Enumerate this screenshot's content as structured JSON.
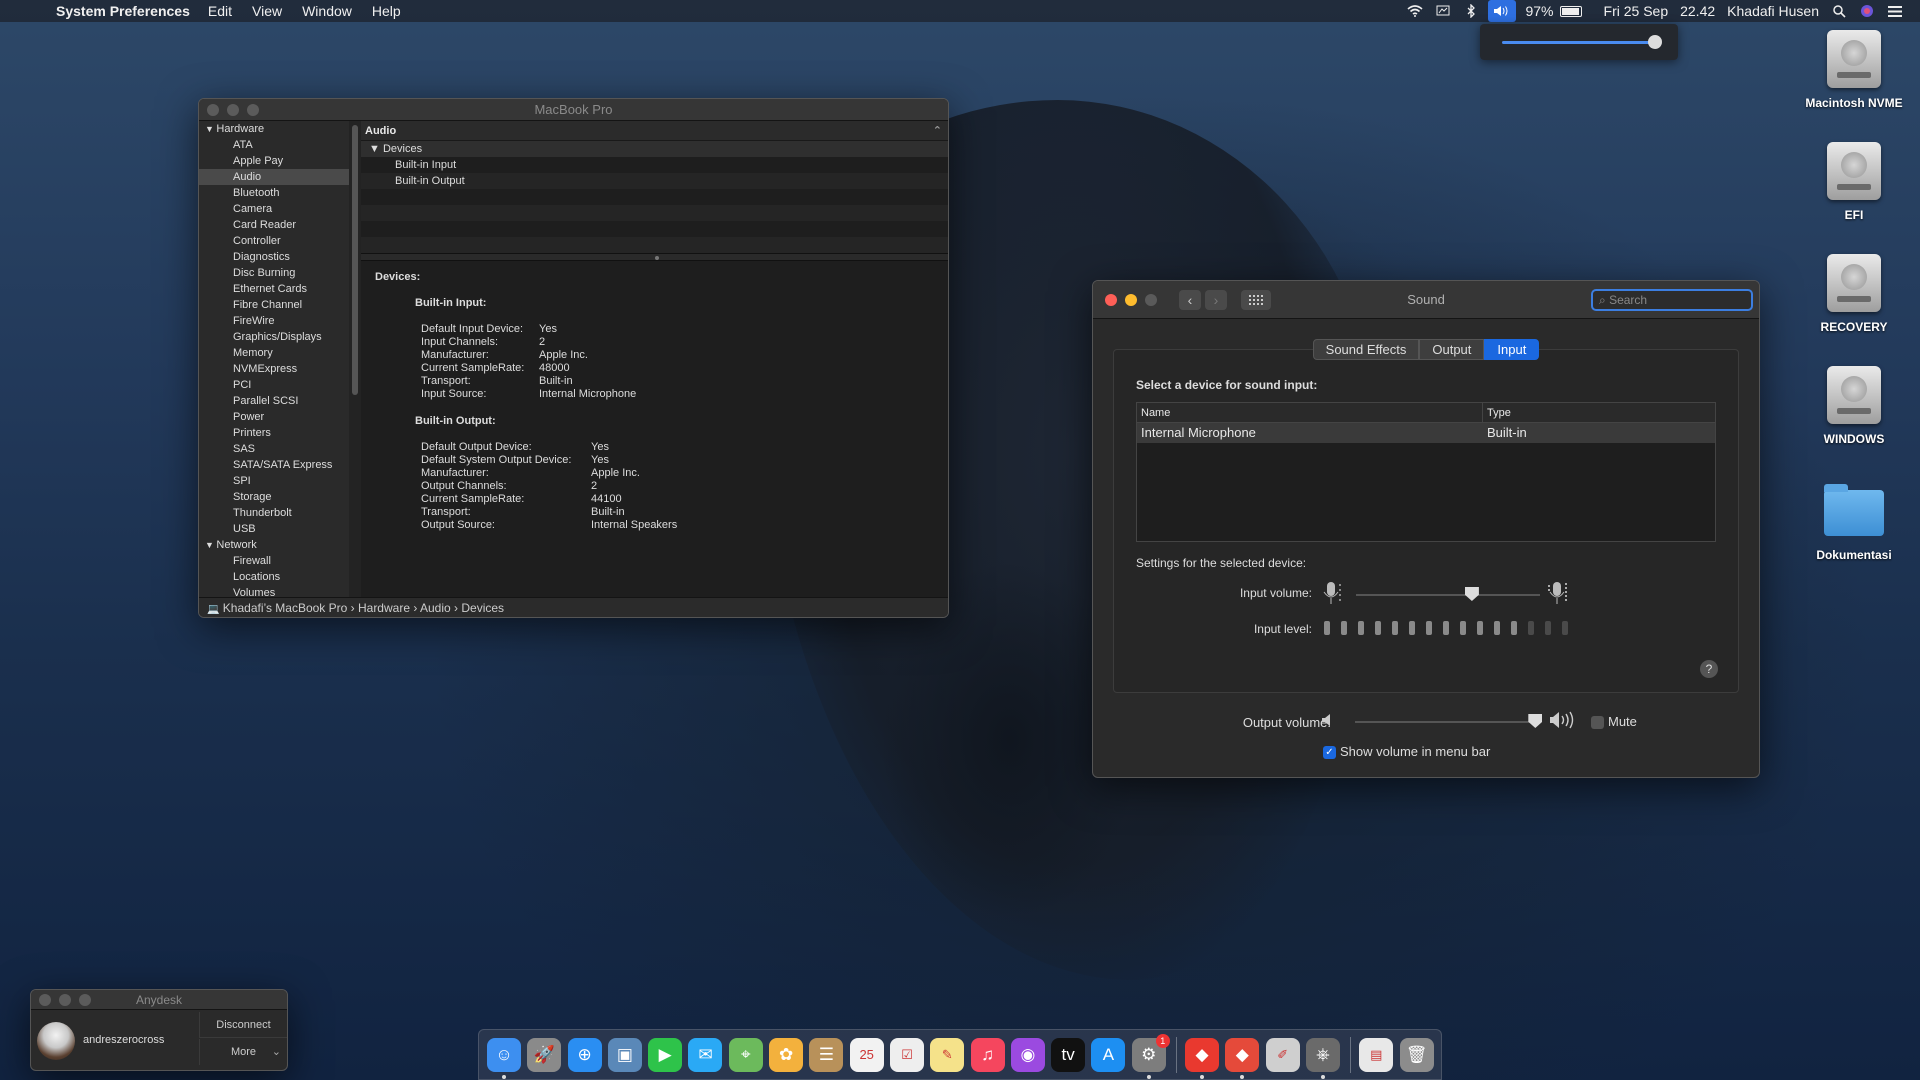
{
  "menubar": {
    "app_name": "System Preferences",
    "menus": [
      "Edit",
      "View",
      "Window",
      "Help"
    ],
    "battery_percent": "97%",
    "battery_level": 0.97,
    "date": "Fri 25 Sep",
    "time": "22.42",
    "user": "Khadafi Husen",
    "icons": [
      "wifi-icon",
      "display-icon",
      "bluetooth-icon",
      "volume-icon",
      "battery-icon",
      "spotlight-icon",
      "siri-icon",
      "notification-center-icon"
    ]
  },
  "volume_popup": {
    "level": 1.0
  },
  "desktop_icons": [
    {
      "label": "Macintosh NVME",
      "type": "disk"
    },
    {
      "label": "EFI",
      "type": "disk"
    },
    {
      "label": "RECOVERY",
      "type": "disk"
    },
    {
      "label": "WINDOWS",
      "type": "disk"
    },
    {
      "label": "Dokumentasi",
      "type": "folder"
    }
  ],
  "sysinfo": {
    "title": "MacBook Pro",
    "sidebar": [
      {
        "label": "Hardware",
        "group": true
      },
      {
        "label": "ATA"
      },
      {
        "label": "Apple Pay"
      },
      {
        "label": "Audio",
        "selected": true
      },
      {
        "label": "Bluetooth"
      },
      {
        "label": "Camera"
      },
      {
        "label": "Card Reader"
      },
      {
        "label": "Controller"
      },
      {
        "label": "Diagnostics"
      },
      {
        "label": "Disc Burning"
      },
      {
        "label": "Ethernet Cards"
      },
      {
        "label": "Fibre Channel"
      },
      {
        "label": "FireWire"
      },
      {
        "label": "Graphics/Displays"
      },
      {
        "label": "Memory"
      },
      {
        "label": "NVMExpress"
      },
      {
        "label": "PCI"
      },
      {
        "label": "Parallel SCSI"
      },
      {
        "label": "Power"
      },
      {
        "label": "Printers"
      },
      {
        "label": "SAS"
      },
      {
        "label": "SATA/SATA Express"
      },
      {
        "label": "SPI"
      },
      {
        "label": "Storage"
      },
      {
        "label": "Thunderbolt"
      },
      {
        "label": "USB"
      },
      {
        "label": "Network",
        "group": true
      },
      {
        "label": "Firewall"
      },
      {
        "label": "Locations"
      },
      {
        "label": "Volumes"
      }
    ],
    "section_header": "Audio",
    "tree_group": "Devices",
    "tree_items": [
      "Built-in Input",
      "Built-in Output"
    ],
    "detail_heading": "Devices:",
    "input_heading": "Built-in Input:",
    "input_props": [
      {
        "k": "Default Input Device:",
        "v": "Yes"
      },
      {
        "k": "Input Channels:",
        "v": "2"
      },
      {
        "k": "Manufacturer:",
        "v": "Apple Inc."
      },
      {
        "k": "Current SampleRate:",
        "v": "48000"
      },
      {
        "k": "Transport:",
        "v": "Built-in"
      },
      {
        "k": "Input Source:",
        "v": "Internal Microphone"
      }
    ],
    "output_heading": "Built-in Output:",
    "output_props": [
      {
        "k": "Default Output Device:",
        "v": "Yes"
      },
      {
        "k": "Default System Output Device:",
        "v": "Yes"
      },
      {
        "k": "Manufacturer:",
        "v": "Apple Inc."
      },
      {
        "k": "Output Channels:",
        "v": "2"
      },
      {
        "k": "Current SampleRate:",
        "v": "44100"
      },
      {
        "k": "Transport:",
        "v": "Built-in"
      },
      {
        "k": "Output Source:",
        "v": "Internal Speakers"
      }
    ],
    "breadcrumb": "Khadafi’s MacBook Pro  ›  Hardware  ›  Audio  ›  Devices"
  },
  "sound": {
    "title": "Sound",
    "search_placeholder": "Search",
    "tabs": [
      "Sound Effects",
      "Output",
      "Input"
    ],
    "selected_tab": "Input",
    "select_device_label": "Select a device for sound input:",
    "col_name": "Name",
    "col_type": "Type",
    "device_name": "Internal Microphone",
    "device_type": "Built-in",
    "settings_label": "Settings for the selected device:",
    "input_volume_label": "Input volume:",
    "input_volume": 0.63,
    "input_level_label": "Input level:",
    "input_level_lit": 12,
    "input_level_total": 15,
    "output_volume_label": "Output volume:",
    "output_volume": 0.98,
    "mute_label": "Mute",
    "mute_checked": false,
    "show_volume_label": "Show volume in menu bar",
    "show_volume_checked": true,
    "help": "?"
  },
  "anydesk": {
    "title": "Anydesk",
    "user": "andreszerocross",
    "disconnect": "Disconnect",
    "more": "More"
  },
  "dock": {
    "apps": [
      {
        "name": "finder-icon",
        "glyph": "☺",
        "color": "#3d8ff0",
        "running": true
      },
      {
        "name": "launchpad-icon",
        "glyph": "🚀",
        "color": "#8a8a8a"
      },
      {
        "name": "safari-icon",
        "glyph": "⊕",
        "color": "#2a8ef2"
      },
      {
        "name": "preview-icon",
        "glyph": "▣",
        "color": "#5a88b8"
      },
      {
        "name": "facetime-icon",
        "glyph": "▶",
        "color": "#2ec34a"
      },
      {
        "name": "messages-icon",
        "glyph": "✉",
        "color": "#2aa9f5"
      },
      {
        "name": "maps-icon",
        "glyph": "⌖",
        "color": "#6cba5c"
      },
      {
        "name": "photos-icon",
        "glyph": "✿",
        "color": "#f3b13d"
      },
      {
        "name": "contacts-icon",
        "glyph": "☰",
        "color": "#b8915a"
      },
      {
        "name": "calendar-icon",
        "glyph": "25",
        "color": "#f2f2f2"
      },
      {
        "name": "reminders-icon",
        "glyph": "☑",
        "color": "#eeeeee"
      },
      {
        "name": "notes-icon",
        "glyph": "✎",
        "color": "#f5e28a"
      },
      {
        "name": "music-icon",
        "glyph": "♫",
        "color": "#f5465e"
      },
      {
        "name": "podcasts-icon",
        "glyph": "◉",
        "color": "#9b4ae0"
      },
      {
        "name": "apple-tv-icon",
        "glyph": "tv",
        "color": "#111111"
      },
      {
        "name": "app-store-icon",
        "glyph": "A",
        "color": "#1d8ff2"
      },
      {
        "name": "system-preferences-icon",
        "glyph": "⚙",
        "color": "#7d7d7d",
        "running": true,
        "badge": "1"
      },
      {
        "sep": true
      },
      {
        "name": "anydesk-icon",
        "glyph": "◆",
        "color": "#e9392f",
        "running": true
      },
      {
        "name": "anydesk-alt-icon",
        "glyph": "◆",
        "color": "#e54a3a",
        "running": true
      },
      {
        "name": "script-editor-icon",
        "glyph": "✐",
        "color": "#cfcfcf"
      },
      {
        "name": "system-information-icon",
        "glyph": "⎈",
        "color": "#6a6a6a",
        "running": true
      },
      {
        "sep": true
      },
      {
        "name": "documents-stack-icon",
        "glyph": "▤",
        "color": "#e8e8e8"
      },
      {
        "name": "trash-icon",
        "glyph": "🗑",
        "color": "#8c8c8c"
      }
    ]
  }
}
